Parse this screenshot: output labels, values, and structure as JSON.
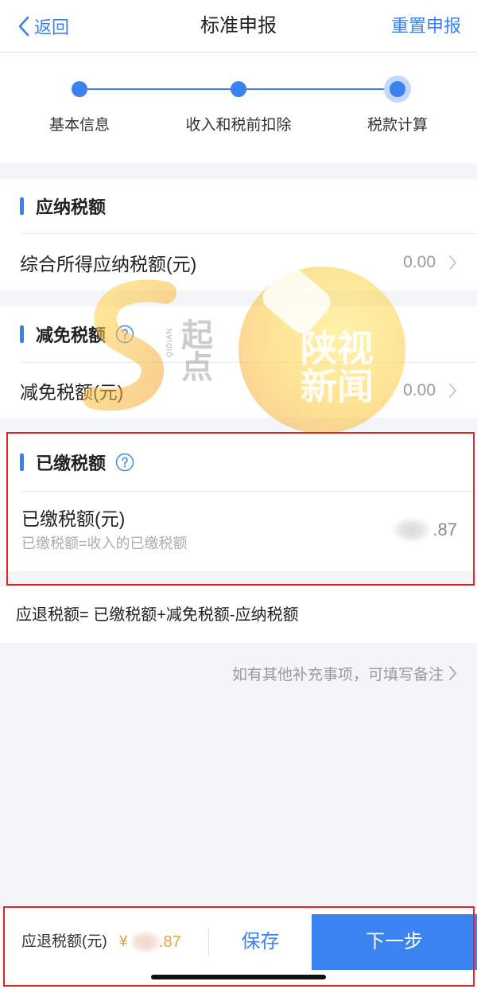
{
  "nav": {
    "back_label": "返回",
    "back_icon": "chevron-left-icon",
    "title": "标准申报",
    "reset_label": "重置申报"
  },
  "stepper": {
    "current_step": 3,
    "steps": [
      {
        "label": "基本信息"
      },
      {
        "label": "收入和税前扣除"
      },
      {
        "label": "税款计算"
      }
    ]
  },
  "sections": {
    "payable": {
      "title": "应纳税额",
      "row_label": "综合所得应纳税额(元)",
      "row_value": "0.00",
      "row_icon": "chevron-right-icon"
    },
    "reduction": {
      "title": "减免税额",
      "help_icon": "help-circle-icon",
      "row_label": "减免税额(元)",
      "row_value": "0.00",
      "row_icon": "chevron-right-icon"
    },
    "paid": {
      "title": "已缴税额",
      "help_icon": "help-circle-icon",
      "row_label": "已缴税额(元)",
      "row_hint": "已缴税额=收入的已缴税额",
      "row_value_visible": ".87"
    }
  },
  "formula": "应退税额= 已缴税额+减免税额-应纳税额",
  "remark_link": {
    "label": "如有其他补充事项，可填写备注",
    "icon": "chevron-right-icon"
  },
  "footer": {
    "refund_label": "应退税额(元)",
    "currency": "¥",
    "refund_value_visible": ".87",
    "save_label": "保存",
    "next_label": "下一步"
  },
  "watermarks": {
    "qidian_latin": "QIDIAN",
    "qidian_cn": "起点",
    "news_line1": "陕视",
    "news_line2": "新闻"
  },
  "colors": {
    "accent": "#3a82f0",
    "highlight": "#e02424",
    "amount": "#e6a23c",
    "page_bg": "#f4f5f9"
  }
}
